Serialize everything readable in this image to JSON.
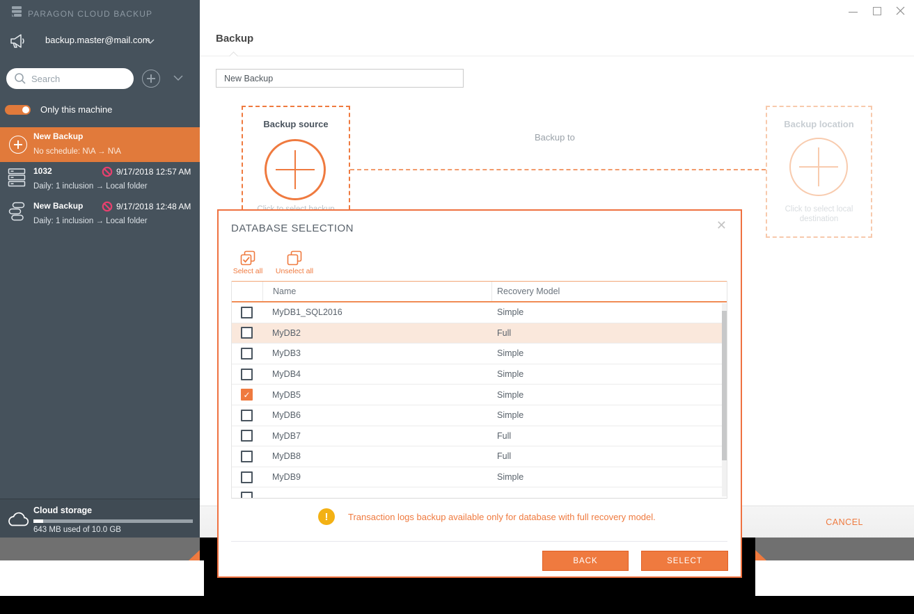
{
  "colors": {
    "accent": "#EF7A3F",
    "accent_dark": "#E05F25",
    "sidebar_bg": "#46525C",
    "sidebar_selected": "#E17A3B",
    "ban": "#E8406E",
    "warning": "#F3B114",
    "row_highlight": "#FAE8DC",
    "gray_band": "#707070"
  },
  "sidebar": {
    "app_title": "PARAGON CLOUD BACKUP",
    "account_email": "backup.master@mail.com",
    "search_placeholder": "Search",
    "machine_toggle_label": "Only this machine",
    "backups": [
      {
        "name": "New Backup",
        "schedule": "No schedule: N\\A → N\\A",
        "selected": true
      },
      {
        "name": "1032",
        "timestamp": "9/17/2018 12:57 AM",
        "schedule": "Daily: 1 inclusion → Local folder",
        "selected": false
      },
      {
        "name": "New Backup",
        "timestamp": "9/17/2018 12:48 AM",
        "schedule": "Daily: 1 inclusion → Local folder",
        "selected": false
      }
    ],
    "cloud_storage": {
      "title": "Cloud storage",
      "usage": "643 MB used of 10.0 GB",
      "used_percent": 6.3
    }
  },
  "main": {
    "page_title": "Backup",
    "name_input_value": "New Backup",
    "source_card_title": "Backup source",
    "source_card_hint": "Click to select backup",
    "backup_to_label": "Backup to",
    "location_card_title": "Backup location",
    "location_card_hint": "Click to select local destination",
    "cancel_label": "CANCEL"
  },
  "dialog": {
    "title": "DATABASE SELECTION",
    "close_glyph": "✕",
    "select_all_label": "Select all",
    "unselect_all_label": "Unselect all",
    "check_glyph": "✓",
    "columns": [
      "Name",
      "Recovery Model"
    ],
    "rows": [
      {
        "name": "MyDB1_SQL2016",
        "recovery": "Simple",
        "checked": false,
        "highlighted": false
      },
      {
        "name": "MyDB2",
        "recovery": "Full",
        "checked": false,
        "highlighted": true
      },
      {
        "name": "MyDB3",
        "recovery": "Simple",
        "checked": false,
        "highlighted": false
      },
      {
        "name": "MyDB4",
        "recovery": "Simple",
        "checked": false,
        "highlighted": false
      },
      {
        "name": "MyDB5",
        "recovery": "Simple",
        "checked": true,
        "highlighted": false
      },
      {
        "name": "MyDB6",
        "recovery": "Simple",
        "checked": false,
        "highlighted": false
      },
      {
        "name": "MyDB7",
        "recovery": "Full",
        "checked": false,
        "highlighted": false
      },
      {
        "name": "MyDB8",
        "recovery": "Full",
        "checked": false,
        "highlighted": false
      },
      {
        "name": "MyDB9",
        "recovery": "Simple",
        "checked": false,
        "highlighted": false
      },
      {
        "name": "",
        "recovery": "",
        "checked": false,
        "highlighted": false
      }
    ],
    "warning_glyph": "!",
    "warning_text": "Transaction logs backup available only for database with full recovery model.",
    "back_label": "BACK",
    "select_label": "SELECT"
  }
}
